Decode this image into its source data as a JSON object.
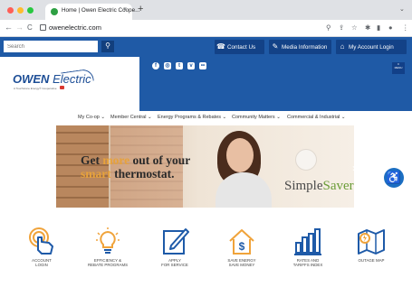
{
  "browser": {
    "tab_title": "Home | Owen Electric Coope...",
    "tab_close": "×",
    "new_tab": "+",
    "tab_more": "⌄",
    "url": "owenelectric.com",
    "back": "←",
    "forward": "→",
    "reload": "C",
    "toolbar_icons": [
      "search-icon",
      "share-icon",
      "star-icon",
      "extensions-icon",
      "sidebar-icon",
      "profile-icon",
      "more-icon"
    ]
  },
  "sitebar": {
    "search_placeholder": "Search",
    "search_icon": "search-icon",
    "buttons": [
      {
        "label": "Contact Us",
        "icon": "contact-icon"
      },
      {
        "label": "Media Information",
        "icon": "pencil-icon"
      },
      {
        "label": "My Account Login",
        "icon": "home-icon"
      }
    ]
  },
  "header": {
    "logo_bold": "OWEN",
    "logo_light": " Electric",
    "tagline": "A Touchstone Energy® Cooperative",
    "social_icons": [
      "facebook-icon",
      "instagram-icon",
      "twitter-icon",
      "vimeo-icon",
      "flickr-icon"
    ],
    "menu_label": "MENU"
  },
  "nav": {
    "items": [
      {
        "label": "My Co-op ⌄"
      },
      {
        "label": "Member Central ⌄"
      },
      {
        "label": "Energy Programs & Rebates ⌄"
      },
      {
        "label": "Community Matters ⌄"
      },
      {
        "label": "Commercial & Industrial ⌄"
      }
    ]
  },
  "hero": {
    "line1_a": "Get ",
    "line1_b": "more",
    "line1_c": " out of your",
    "line2_a": "smart",
    "line2_b": " thermostat.",
    "brand_a": "Simple",
    "brand_b": "Saver",
    "prev": "‹",
    "next": "›"
  },
  "accessibility_icon": "accessibility-icon",
  "quick_links": [
    {
      "line1": "ACCOUNT",
      "line2": "LOGIN",
      "icon": "touch-hand-icon"
    },
    {
      "line1": "EFFICIENCY &",
      "line2": "REBATE PROGRAMS",
      "icon": "lightbulb-icon"
    },
    {
      "line1": "APPLY",
      "line2": "FOR SERVICE",
      "icon": "edit-form-icon"
    },
    {
      "line1": "SAVE ENERGY",
      "line2": "SAVE MONEY",
      "icon": "house-dollar-icon"
    },
    {
      "line1": "RATES AND",
      "line2": "TARIFFS INDEX",
      "icon": "bar-chart-icon"
    },
    {
      "line1": "OUTAGE MAP",
      "line2": "",
      "icon": "map-icon"
    }
  ],
  "colors": {
    "brand_blue": "#1f5aa6",
    "dark_blue": "#134287",
    "orange": "#e7a23b",
    "icon_blue": "#1e5aa8",
    "icon_orange": "#f0a33a"
  }
}
